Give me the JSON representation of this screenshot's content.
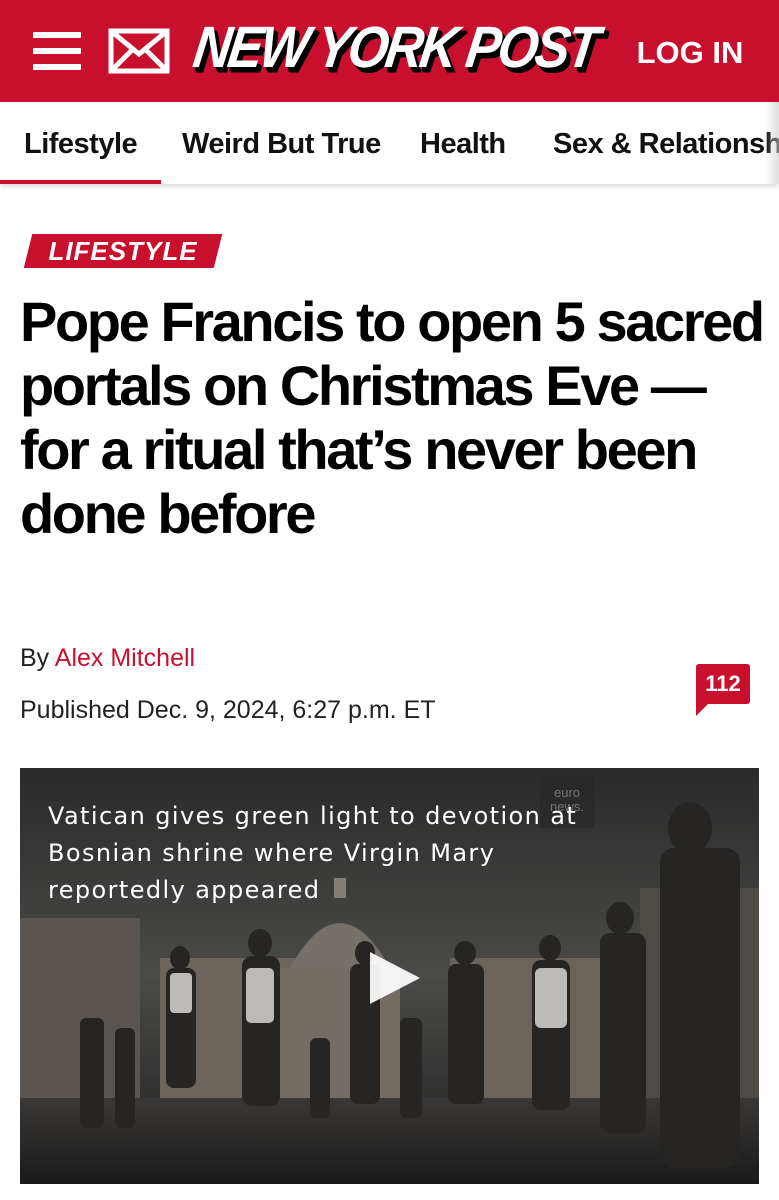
{
  "header": {
    "logo_text": "NEW YORK POST",
    "login_label": "LOG IN",
    "menu_icon": "hamburger-icon",
    "mail_icon": "mail-icon"
  },
  "sections": {
    "tabs": [
      {
        "label": "Lifestyle",
        "active": true
      },
      {
        "label": "Weird But True"
      },
      {
        "label": "Health"
      },
      {
        "label": "Sex & Relationships"
      }
    ]
  },
  "article": {
    "kicker": "LIFESTYLE",
    "headline": "Pope Francis to open 5 sacred portals on Christmas Eve — for a ritual that’s never been done before",
    "byline_prefix": "By",
    "author": "Alex Mitchell",
    "published": "Published Dec. 9, 2024, 6:27 p.m. ET",
    "comment_count": "112"
  },
  "video": {
    "title": "Vatican gives green light to devotion at Bosnian shrine where Virgin Mary reportedly appeared",
    "watermark": "euro news.",
    "play_icon": "play-icon"
  },
  "colors": {
    "brand_red": "#c8102e",
    "text": "#000000"
  }
}
